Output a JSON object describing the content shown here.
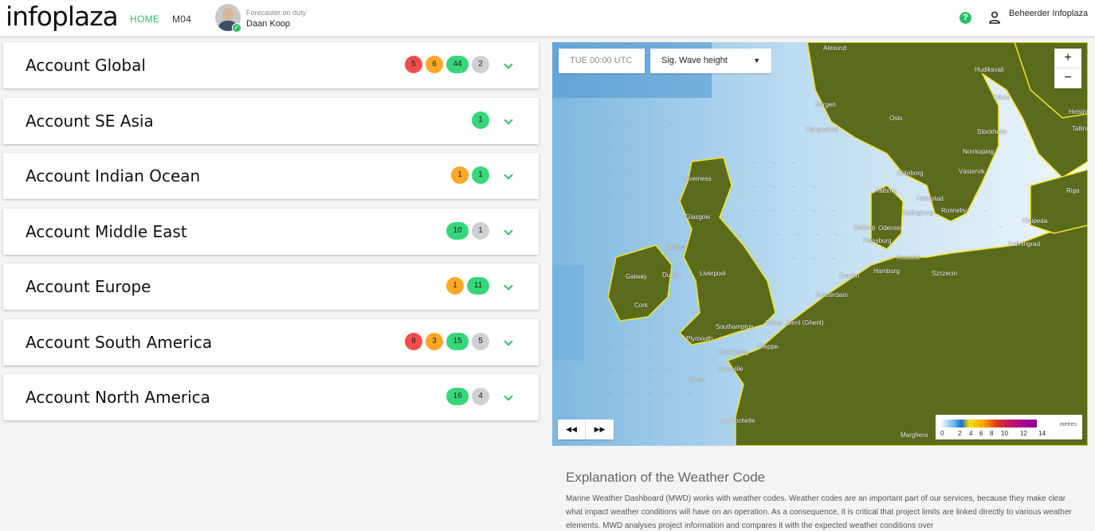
{
  "header": {
    "logo": "infoplaza",
    "nav": [
      "HOME",
      "M04"
    ],
    "duty_label": "Forecaster on duty",
    "duty_name": "Daan Koop",
    "user": "Beheerder Infoplaza",
    "icons": [
      "help-icon",
      "user-icon",
      "avatar"
    ]
  },
  "accounts": [
    {
      "name": "Account Global",
      "badges": [
        {
          "value": "5",
          "color": "#f44d4d"
        },
        {
          "value": "6",
          "color": "#ffa726"
        },
        {
          "value": "44",
          "color": "#37d67a"
        },
        {
          "value": "2",
          "color": "#d0d0d0"
        }
      ]
    },
    {
      "name": "Account SE Asia",
      "badges": [
        {
          "value": "1",
          "color": "#37d67a"
        }
      ]
    },
    {
      "name": "Account Indian Ocean",
      "badges": [
        {
          "value": "1",
          "color": "#ffa726"
        },
        {
          "value": "1",
          "color": "#37d67a"
        }
      ]
    },
    {
      "name": "Account Middle East",
      "badges": [
        {
          "value": "10",
          "color": "#37d67a"
        },
        {
          "value": "1",
          "color": "#d0d0d0"
        }
      ]
    },
    {
      "name": "Account Europe",
      "badges": [
        {
          "value": "1",
          "color": "#ffa726"
        },
        {
          "value": "11",
          "color": "#37d67a"
        }
      ]
    },
    {
      "name": "Account South America",
      "badges": [
        {
          "value": "8",
          "color": "#f44d4d"
        },
        {
          "value": "3",
          "color": "#ffa726"
        },
        {
          "value": "15",
          "color": "#37d67a"
        },
        {
          "value": "5",
          "color": "#d0d0d0"
        }
      ]
    },
    {
      "name": "Account North America",
      "badges": [
        {
          "value": "16",
          "color": "#37d67a"
        },
        {
          "value": "4",
          "color": "#d0d0d0"
        }
      ]
    }
  ],
  "map": {
    "time": "TUE 00:00 UTC",
    "layer": "Sig. Wave height",
    "zoom_in": "+",
    "zoom_out": "−",
    "rewind": "◀◀",
    "forward": "▶▶",
    "legend_ticks": [
      "0",
      "2",
      "4",
      "6",
      "8",
      "10",
      "12",
      "14"
    ],
    "legend_unit": "metres",
    "cities": [
      "Alesund",
      "Hudiksvall",
      "Gävle",
      "Helsinki",
      "Tallinn",
      "Bergen",
      "Oslo",
      "Haugesund",
      "Stockholm",
      "Norrkoping",
      "Västervik",
      "Göteborg",
      "Inverness",
      "Aalborg",
      "Halmstad",
      "Kelingborg",
      "Ronneby",
      "Riga",
      "Glasgow",
      "Esbjerg",
      "Odense",
      "Klaipeda",
      "Flensburg",
      "Rostock",
      "Kaliningrad",
      "Belfast",
      "Hamburg",
      "Szczecin",
      "Galway",
      "Dublin",
      "Liverpool",
      "Emden",
      "Amsterdam",
      "Cork",
      "Southampton",
      "Dover",
      "Gent (Ghent)",
      "Plymouth",
      "Cherbourg",
      "Dieppe",
      "Granville",
      "Brest",
      "La Rochelle",
      "Marghera"
    ]
  },
  "explanation": {
    "title": "Explanation of the Weather Code",
    "text": "Marine Weather Dashboard (MWD) works with weather codes. Weather codes are an important part of our services, because they make clear what impact weather conditions will have on an operation. As a consequence, it is critical that project limits are linked directly to various weather elements. MWD analyses project information and compares it with the expected weather conditions over"
  }
}
